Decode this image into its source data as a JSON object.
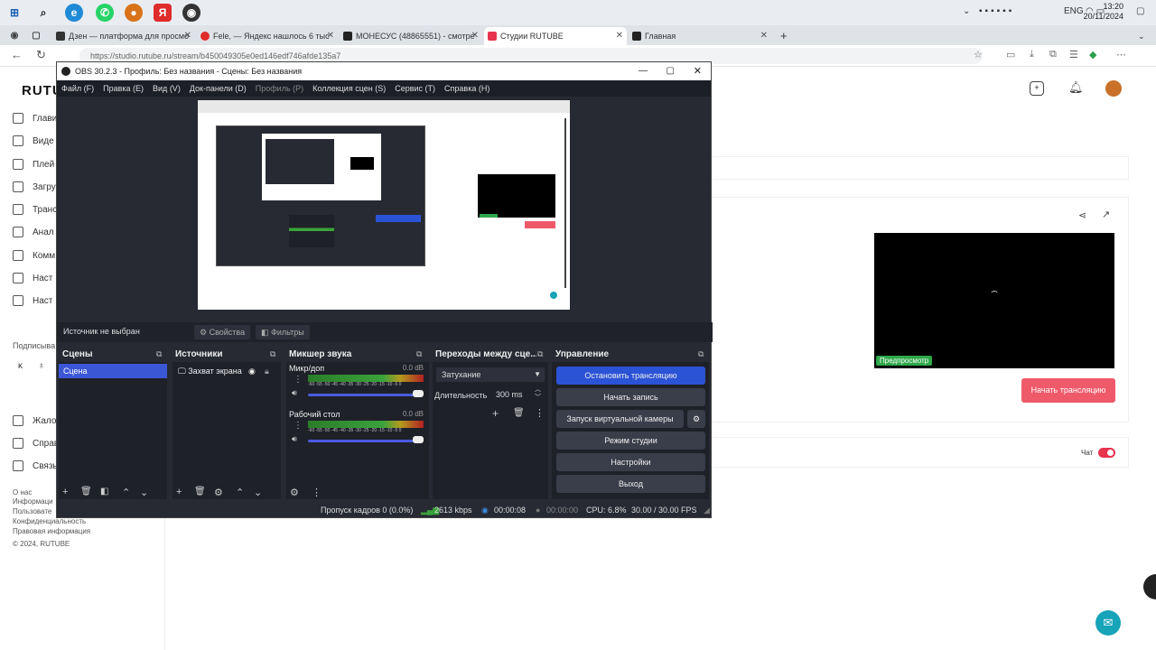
{
  "taskbar": {
    "clock_time": "13:20",
    "clock_date": "20/11/2024",
    "lang": "ENG"
  },
  "browser": {
    "tabs": [
      {
        "label": "Дзен — платформа для просмо"
      },
      {
        "label": "Fele, — Яндекс нашлось 6 тыс"
      },
      {
        "label": "МОНЕСУС (48865551) - смотре"
      },
      {
        "label": "Студии RUTUBE"
      },
      {
        "label": "Главная"
      }
    ],
    "url": "https://studio.rutube.ru/stream/b450049305e0ed146edf746afde135a7"
  },
  "rutube": {
    "logo": "RUTU",
    "sidebar": [
      "Глави",
      "Виде",
      "Плей",
      "Загру",
      "Транс",
      "Анал",
      "Комм",
      "Наст"
    ],
    "subscriptions_label": "Подписыва",
    "sidebar2": [
      "Жало",
      "Справ",
      "Связь"
    ],
    "footer": [
      "О нас",
      "Информаци",
      "Пользовате",
      "Конфиденциальность",
      "Информация",
      "Правовая информация",
      "© 2024, RUTUBE"
    ],
    "preview_badge": "Предпросмотр",
    "start_stream": "Начать трансляцию",
    "chat_label": "Чат"
  },
  "obs": {
    "title": "OBS 30.2.3 - Профиль: Без названия - Сцены: Без названия",
    "menu": [
      "Файл (F)",
      "Правка (E)",
      "Вид (V)",
      "Док-панели (D)",
      "Профиль (P)",
      "Коллекция сцен (S)",
      "Сервис (T)",
      "Справка (H)"
    ],
    "no_source": "Источник не выбран",
    "properties": "Свойства",
    "filters": "Фильтры",
    "docks": {
      "scenes": "Сцены",
      "sources": "Источники",
      "mixer": "Микшер звука",
      "transitions": "Переходы между сце...",
      "controls": "Управление"
    },
    "scene_item": "Сцена",
    "source_item": "Захват экрана",
    "mixer_channels": [
      {
        "name": "Микр/доп",
        "db": "0.0 dB"
      },
      {
        "name": "Рабочий стол",
        "db": "0.0 dB"
      }
    ],
    "meter_ticks": "-60 -55 -50 -45 -40 -35 -30 -25 -20 -15 -10 -5 0",
    "transition_select": "Затухание",
    "duration_label": "Длительность",
    "duration_value": "300 ms",
    "controls": [
      "Остановить трансляцию",
      "Начать запись",
      "Запуск виртуальной камеры",
      "Режим студии",
      "Настройки",
      "Выход"
    ],
    "status": {
      "dropped": "Пропуск кадров 0 (0.0%)",
      "bitrate": "2613 kbps",
      "stream_time": "00:00:08",
      "rec_time": "00:00:00",
      "cpu": "CPU: 6.8%",
      "fps": "30.00 / 30.00 FPS"
    }
  }
}
